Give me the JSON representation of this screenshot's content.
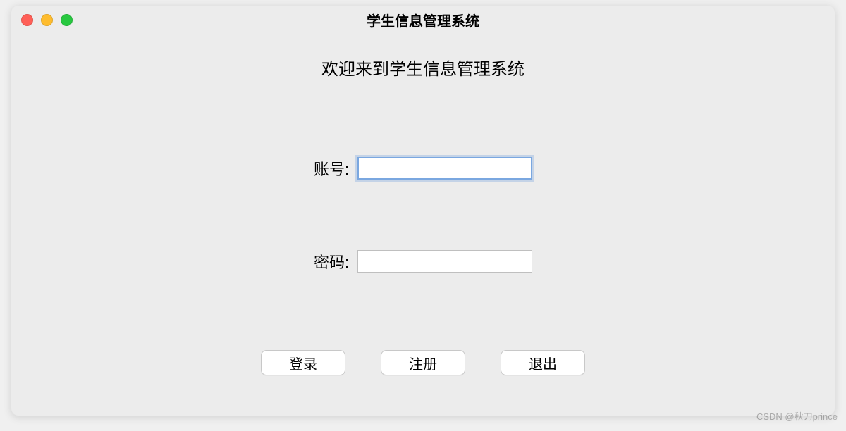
{
  "window": {
    "title": "学生信息管理系统"
  },
  "content": {
    "welcome": "欢迎来到学生信息管理系统",
    "account_label": "账号:",
    "password_label": "密码:",
    "account_value": "",
    "password_value": ""
  },
  "buttons": {
    "login": "登录",
    "register": "注册",
    "exit": "退出"
  },
  "watermark": "CSDN @秋刀prince"
}
